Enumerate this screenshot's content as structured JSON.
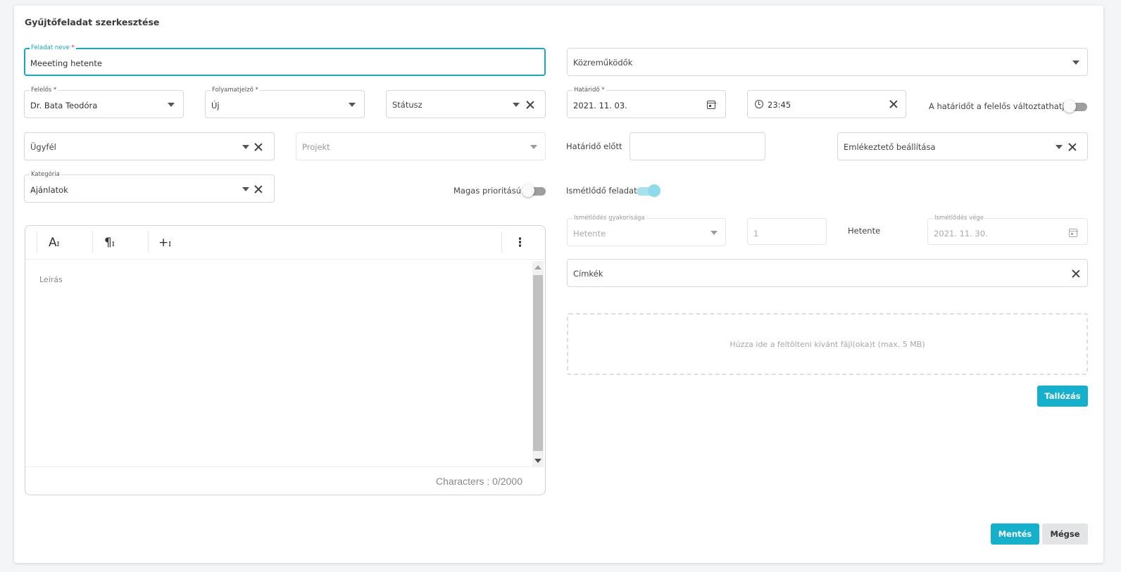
{
  "title": "Gyűjtőfeladat szerkesztése",
  "task_name": {
    "label": "Feladat neve",
    "required": "*",
    "value": "Meeeting hetente"
  },
  "contributors": {
    "placeholder": "Közreműködők"
  },
  "responsible": {
    "label": "Felelős",
    "required": "*",
    "value": "Dr. Bata Teodóra"
  },
  "progress": {
    "label": "Folyamatjelző",
    "required": "*",
    "value": "Új"
  },
  "status": {
    "placeholder": "Státusz"
  },
  "deadline": {
    "label": "Határidő",
    "required": "*",
    "value": "2021. 11. 03."
  },
  "time": {
    "value": "23:45"
  },
  "deadline_editable": {
    "label": "A határidőt a felelős változtathatja",
    "on": false
  },
  "client": {
    "placeholder": "Ügyfél"
  },
  "project": {
    "placeholder": "Projekt"
  },
  "before_deadline": {
    "label": "Határidő előtt",
    "value": ""
  },
  "reminder": {
    "placeholder": "Emlékeztető beállítása"
  },
  "category": {
    "label": "Kategória",
    "value": "Ajánlatok"
  },
  "high_priority": {
    "label": "Magas prioritású",
    "on": false
  },
  "recurring": {
    "label": "Ismétlődő feladat",
    "on": true
  },
  "recurrence_freq": {
    "label": "Ismétlődés gyakorisága",
    "value": "Hetente"
  },
  "recurrence_count": {
    "value": "1"
  },
  "recurrence_unit": "Hetente",
  "recurrence_end": {
    "label": "Ismétlődés vége",
    "value": "2021. 11. 30."
  },
  "tags": {
    "placeholder": "Címkék"
  },
  "editor": {
    "tools": {
      "font": "A",
      "paragraph": "¶",
      "insert": "+",
      "more": "⋮"
    },
    "placeholder": "Leírás",
    "char_count": "Characters : 0/2000"
  },
  "dropzone": {
    "text": "Húzza ide a feltölteni kívánt fájl(oka)t (max. 5 MB)"
  },
  "browse_label": "Tallózás",
  "save_label": "Mentés",
  "cancel_label": "Mégse",
  "colors": {
    "accent": "#14b0cc",
    "required": "#e0245e",
    "toggle_on": "#8fdbe9"
  }
}
